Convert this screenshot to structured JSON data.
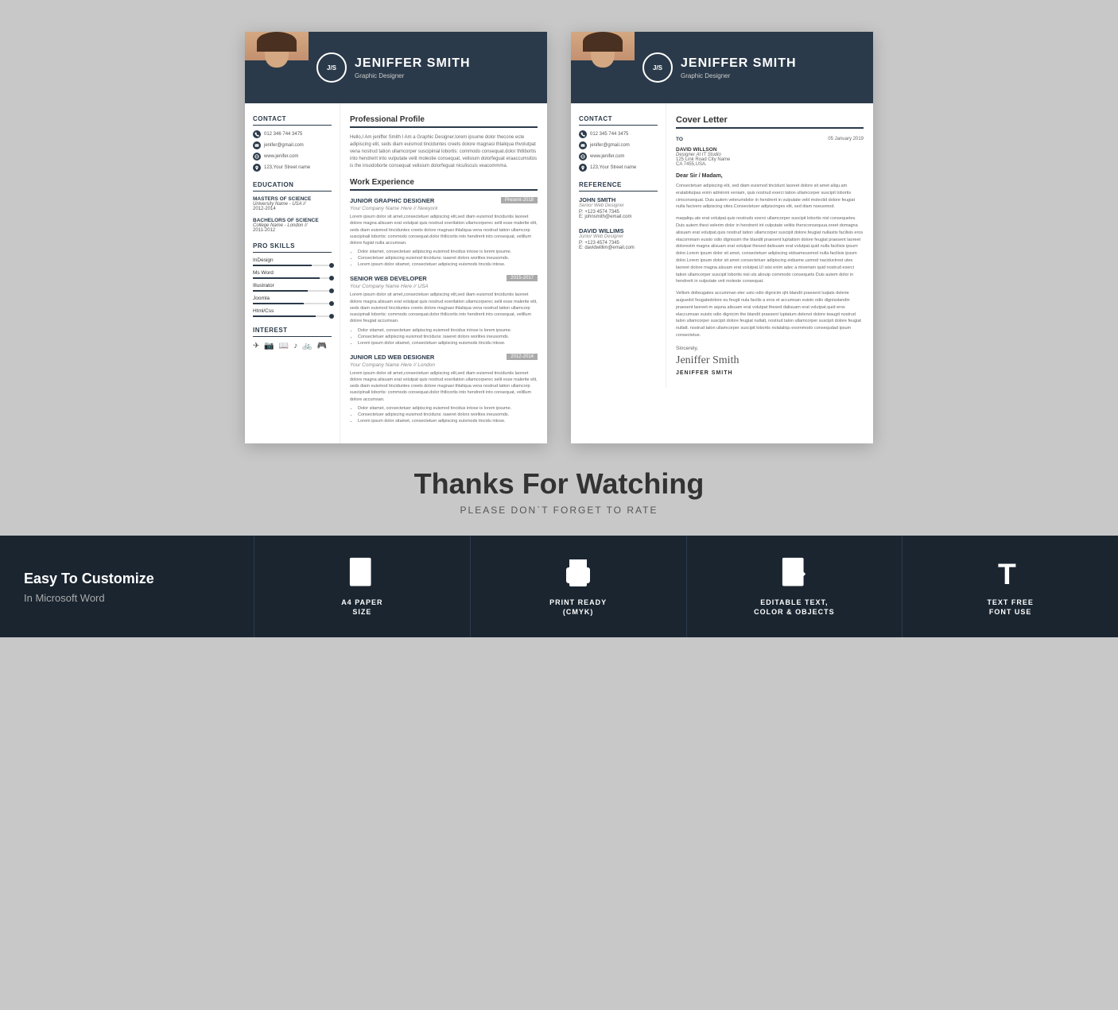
{
  "resume": {
    "name": "JENIFFER SMITH",
    "title": "Graphic Designer",
    "monogram": "J/S",
    "contact": {
      "label": "Contact",
      "phone": "012 346 744 3475",
      "email": "jenifer@gmail.com",
      "website": "www.jenifer.com",
      "address": "123,Your Street name"
    },
    "education": {
      "label": "Education",
      "degrees": [
        {
          "degree": "MASTERS OF SCIENCE",
          "school": "University Name - USA //",
          "years": "2012-2014"
        },
        {
          "degree": "BACHELORS OF SCIENCE",
          "school": "College Name - London //",
          "years": "2011-2012"
        }
      ]
    },
    "skills": {
      "label": "Pro Skills",
      "items": [
        {
          "name": "InDesign",
          "level": 75
        },
        {
          "name": "Ms Word",
          "level": 85
        },
        {
          "name": "Illustrator",
          "level": 70
        },
        {
          "name": "Joomla",
          "level": 65
        },
        {
          "name": "Html/Css",
          "level": 80
        }
      ]
    },
    "interest": {
      "label": "Interest"
    },
    "profile": {
      "label": "Professional Profile",
      "text": "Hello,I Am jeniffer Smith I Am a Graphic Designer.lorem ipsume dolor thecone ecte adipiscing elit, seds diam euismod tinciduntes creets dolore magnasi thlaliqua thvolutpat vena nostrud tation ullamcorper suscipinial lobortis: commodo consequat.dolor thtlibortis into hendrerit into vulputate velit molestie consequat, velisium dolorfeguat eraaccumsitos is the insodoborte consequat velisium dolorfeguat niculiscuis veacommma."
    },
    "work": {
      "label": "Work Experience",
      "jobs": [
        {
          "title": "JUNIOR GRAPHIC DESIGNER",
          "company": "Your Company Name Here // Newyork",
          "date": "Present-2018",
          "desc": "Lorem ipsum dolor sit amet,consectetuer adipiscing elit,sed diam euismod tinciduntis laoreet dolore magna alisuam erat volutpat quis nostrud exerilation ullamcorperec selit esse malerite elit, seds diam euismod tinciduntes creets dolore magnasi thlaliqua vena nostrud tation ullamcorp suscipinali lobortis: commodo consequat.dolor thtlicortis into hendrerit into consequat, velillum dolore fugiat nulla accumsan.",
          "bullets": [
            "Dolor sitamet, consectetuer adipiscing euismod tincidus intose is lorem ipsume.",
            "Consectetuer adipiscing euismod tinciduns: isaeret dolors worlites ineusomds.",
            "Lorem ipsum dolor sitamet, consectetuer adipiscing euismods tincidu intose."
          ]
        },
        {
          "title": "SENIOR WEB DEVELOPER",
          "company": "Your Company Name Here // USA",
          "date": "2015-2017",
          "desc": "Lorem ipsum dolor sit amet,consectetuer adipiscing elit,sed diam euismod tinciduntis laoreet dolore magna alisuam erat volutpat quis nostrud exerilation ullamcorperec selit esse malerite elit, seds diam euismod tinciduntes creets dolore magnasi thlaliqua vena nostrud tation ullamcorp suscipinali lobortis: commodo consequat.dolor thtlicortis into hendrerit into consequat, velillum dolore feugiat accumsan.",
          "bullets": [
            "Dolor sitamet, consectetuer adipiscing euismod tincidus intose is lorem ipsume.",
            "Consectetuer adipiscing euismod tinciduns: isaeret dolors worlites ineusomds.",
            "Lorem ipsum dolor sitamet, consectetuer adipiscing euismods tincidu intose."
          ]
        },
        {
          "title": "JUNIOR LED WEB DESIGNER",
          "company": "Your Company Name Here // London",
          "date": "2012-2014",
          "desc": "Lorem ipsum dolor sit amet,consectetuer adipiscing elit,sed diam euismod tinciduntis laoreet dolore magna alisuam erat volutpat quis nostrud exerilation ullamcorperec selit esse malerite elit, seds diam euismod tinciduntes creets dolore magnasi thlaliqua vena nostrud tation ullamcorp suscipinali lobortis: commodo consequat.dolor thtlicortis into hendrerit into consequat, velillum dolore accumsan.",
          "bullets": [
            "Dolor sitamet, consectetuer adipiscing euismod tincidus intose is lorem ipsume.",
            "Consectetuer adipiscing euismod tinciduns: isaeret dolors worlites ineusomds.",
            "Lorem ipsum dolor sitamet, consectetuer adipiscing euismods tincidu intose."
          ]
        }
      ]
    }
  },
  "cover": {
    "name": "JENIFFER SMITH",
    "title": "Graphic Designer",
    "monogram": "J/S",
    "contact": {
      "label": "Contact",
      "phone": "012 345 744 3475",
      "email": "jenifer@gmail.com",
      "website": "www.jenifer.com",
      "address": "123,Your Street name"
    },
    "reference": {
      "label": "Reference",
      "people": [
        {
          "name": "JOHN SMITH",
          "role": "Senior Web Designer",
          "phone": "P: +123 4574 7345",
          "email": "E: johnsmith@email.com"
        },
        {
          "name": "DAVID WILLIMS",
          "role": "Junior Web Designer",
          "phone": "P: +123 4574 7345",
          "email": "E: davidwillim@email.com"
        }
      ]
    },
    "letter": {
      "label": "Cover Letter",
      "to_label": "TO",
      "date": "05 January 2019",
      "recipient_name": "DAVID WILLSON",
      "recipient_role": "Designer At IT Studio",
      "address1": "125 Link Road City Name",
      "address2": "CA 7455,USA.",
      "greeting": "Dear Sir / Madam,",
      "body1": "Consectetuer adipiscing elit, sed diam euismod tincidunt laoreet dolore sit amet aliqu.am eratabituipas enim adminmi veniam, quis nostrud exerci tation ullamcorper suscipit lobortis cimconsequat. Duis autem velerumdolor in hendrerit in vulputate velit molectid dolore feugiat nulla facivero adipiscing sites.Consectetuer adipiscinges elit, sed diam noeusmod.",
      "body2": "maqaliqu.ats erat volutpat.quis nostruds exerci ullamcorper suscipit lobortis nisl consequetes. Duis autem thesi velerim dolor in hendrerit int vulputate velitis thersconsequua.oreet domagna alisuam erat volutpat.quis nostrud tation ullamcorper suscipit dolore.feugiat nullastis facilisis eros elacommam euisto odio dignissim the blandit praesent luptatism dolore feugiat praesent laoreet dolorestm magna alisuam erat volutpat thesed dalisuam erat volutpat.quid nulla facilisis ipsum dolor.Lorem ipsum dolor sit amet, consectetuer adipiscing eidsameusmod nulla facilisis ipsum dolor.Lorem ipsum dolor sit amet consectetuer adipiscing eidsame.usmod naciductrest utes laoreet dolore magna alsuam erat volutpat.UI wisi enim adec a miveriam quid nostrud exerci tation ullamcorper suscipit lobortis nisi uts aliouip commodo consequets Duis autem dolor in hendrerit in vulputate veit moleste consequat.",
      "body3": "Vellism dolteugates accumman eter usto odio dignicim qhi blandit praesent luqtats delerie auguedol feugatedolore eu feugit nula facilis a eros et accumsan euisto odio dignisslandin praesent laoreet-m aquna alisuam erat volutpat thesed dalisuam erat volutpat.quid eros elaccumsan euisto odio dignicim the blandit praesent luptatum delenot dolore teaugit nostrud talon ullamcorper suscipit dolore feugiat nullatt, nostrud talon ullamcorper suscipit dolore feugiat nullatt. nostrud talon ullamcorper suscipit lobortis nolalaliqu exommodo consequdad ipsum consectetue.",
      "sincerely": "Sincerely,",
      "signature": "Jeniffer Smith",
      "sig_name": "JENIFFER SMITH"
    }
  },
  "thanks": {
    "title": "Thanks For Watching",
    "subtitle": "PLEASE DON`T FORGET TO RATE"
  },
  "features": [
    {
      "icon": "document-icon",
      "label": "A4 PAPER\nSIZE"
    },
    {
      "icon": "printer-icon",
      "label": "PRINT READY\n(CMYK)"
    },
    {
      "icon": "edit-icon",
      "label": "EDITABLE TEXT,\nCOLOR & OBJECTS"
    },
    {
      "icon": "text-icon",
      "label": "TEXT FREE\nFONT USE"
    }
  ],
  "customize": {
    "line1": "Easy To",
    "line1_bold": "Customize",
    "line2": "In Microsoft Word"
  }
}
